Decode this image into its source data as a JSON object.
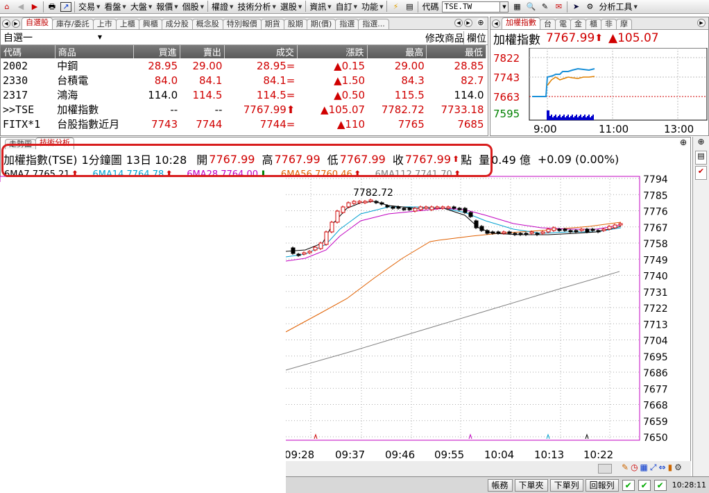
{
  "menubar": {
    "items": [
      "交易",
      "看盤",
      "大盤",
      "報價",
      "個股",
      "權證",
      "技術分析",
      "選股",
      "資訊",
      "自訂",
      "功能"
    ],
    "code_label": "代碼",
    "code_value": "TSE.TW",
    "analysis_tools": "分析工具"
  },
  "watchlist": {
    "tabs": [
      "自選股",
      "庫存/委託",
      "上市",
      "上櫃",
      "興櫃",
      "成分股",
      "概念股",
      "特別報價",
      "期貨",
      "股期",
      "期(價)",
      "指選",
      "指選..."
    ],
    "group": "自選一",
    "edit_label": "修改商品",
    "column_label": "欄位",
    "headers": [
      "代碼",
      "商品",
      "買進",
      "賣出",
      "成交",
      "漲跌",
      "最高",
      "最低"
    ],
    "rows": [
      {
        "code": "2002",
        "name": "中鋼",
        "bid": "28.95",
        "ask": "29.00",
        "last": "28.95=",
        "chg": "▲0.15",
        "high": "29.00",
        "low": "28.85"
      },
      {
        "code": "2330",
        "name": "台積電",
        "bid": "84.0",
        "ask": "84.1",
        "last": "84.1=",
        "chg": "▲1.50",
        "high": "84.3",
        "low": "82.7"
      },
      {
        "code": "2317",
        "name": "鴻海",
        "bid": "114.0",
        "ask": "114.5",
        "last": "114.5=",
        "chg": "▲0.50",
        "high": "115.5",
        "low": "114.0"
      },
      {
        "code": ">>TSE",
        "name": "加權指數",
        "bid": "--",
        "ask": "--",
        "last": "7767.99⬆",
        "chg": "▲105.07",
        "high": "7782.72",
        "low": "7733.18"
      },
      {
        "code": "FITX*1",
        "name": "台股指數近月",
        "bid": "7743",
        "ask": "7744",
        "last": "7744=",
        "chg": "▲110",
        "high": "7765",
        "low": "7685"
      }
    ]
  },
  "index_panel": {
    "tabs": [
      "加權指數",
      "台",
      "電",
      "金",
      "櫃",
      "非",
      "摩"
    ],
    "name": "加權指數",
    "price": "7767.99",
    "arrow": "⬆",
    "change": "▲105.07",
    "y_labels": [
      "7822",
      "7743",
      "7663",
      "7595"
    ],
    "x_labels": [
      "9:00",
      "11:00",
      "13:00"
    ]
  },
  "chart": {
    "tabs": [
      "走勢圖",
      "技術分析"
    ],
    "symbol": "加權指數(TSE)",
    "period": "1分鐘圖",
    "date_time": "13日 10:28",
    "open_label": "開",
    "open": "7767.99",
    "high_label": "高",
    "high": "7767.99",
    "low_label": "低",
    "low": "7767.99",
    "close_label": "收",
    "close": "7767.99",
    "close_arrow": "⬆",
    "unit": "點",
    "vol_label": "量",
    "vol": "0.49 億",
    "chg": "+0.09 (0.00%)",
    "ma": [
      "6MA7 7765.21",
      "6MA14 7764.78",
      "6MA28 7764.00",
      "6MA56 7760.46",
      "6MA112 7741.70"
    ],
    "peak_label": "7782.72",
    "y_labels": [
      "7794",
      "7785",
      "7776",
      "7767",
      "7758",
      "7749",
      "7740",
      "7731",
      "7722",
      "7713",
      "7704",
      "7695",
      "7686",
      "7677",
      "7668",
      "7659",
      "7650"
    ],
    "x_labels": [
      "09:28",
      "09:37",
      "09:46",
      "09:55",
      "10:04",
      "10:13",
      "10:22"
    ]
  },
  "statusbar": {
    "buttons": [
      "帳務",
      "下單夾",
      "下單列",
      "回報列"
    ],
    "time": "10:28:11"
  },
  "colors": {
    "up": "#d00000",
    "down": "#008000",
    "accent": "#0000cc",
    "ma7": "#000000",
    "ma14": "#00a0d0",
    "ma28": "#c000c0",
    "ma56": "#e06000",
    "ma112": "#808080"
  }
}
